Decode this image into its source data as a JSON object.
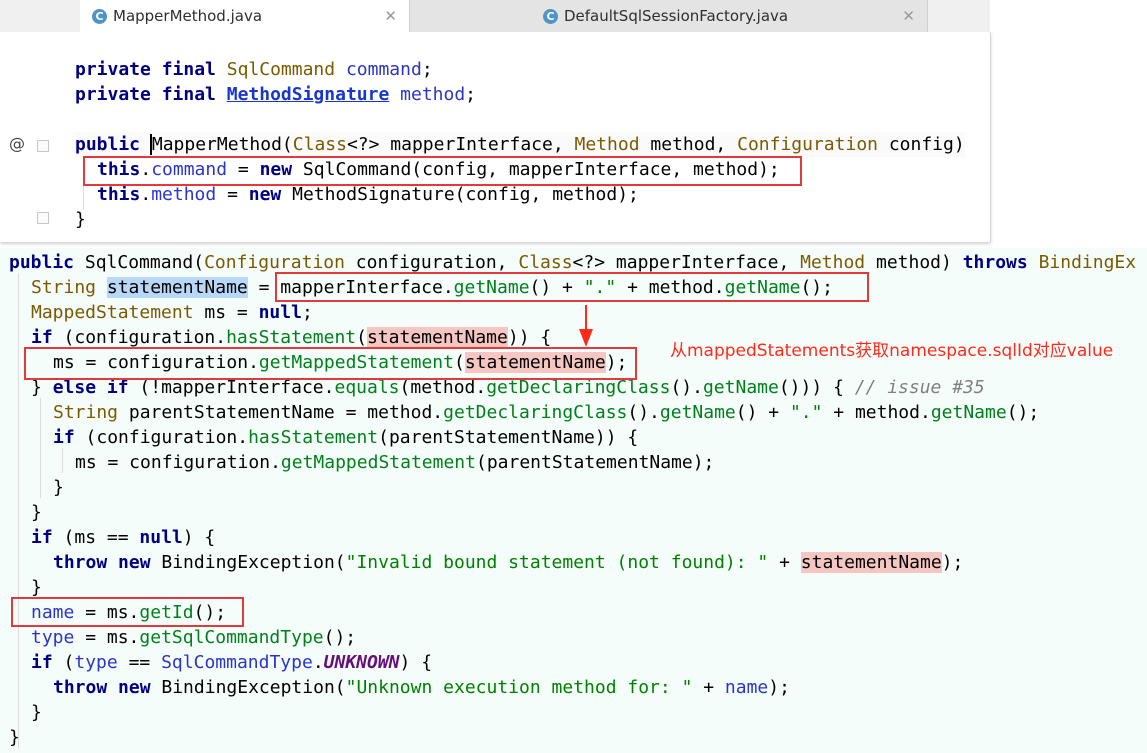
{
  "tabs": [
    {
      "icon": "C",
      "label": "MapperMethod.java",
      "active": true
    },
    {
      "icon": "C",
      "label": "DefaultSqlSessionFactory.java",
      "active": false
    }
  ],
  "top_code": {
    "gutter_symbol": "@",
    "l1": {
      "kw1": "private",
      "kw2": "final",
      "type": "SqlCommand",
      "field": "command",
      "end": ";"
    },
    "l2": {
      "kw1": "private",
      "kw2": "final",
      "type": "MethodSignature",
      "field": "method",
      "end": ";"
    },
    "l3": {
      "kw": "public",
      "name": "MapperMethod",
      "p1": "(",
      "t1": "Class",
      "p2": "<?> mapperInterface, ",
      "t2": "Method",
      "p3": " method, ",
      "t3": "Configuration",
      "p4": " config)"
    },
    "l4": {
      "this": "this",
      "dot": ".",
      "field": "command",
      "eq": " = ",
      "new": "new",
      "rest": " SqlCommand(config, mapperInterface, method);"
    },
    "l5": {
      "this": "this",
      "dot": ".",
      "field": "method",
      "eq": " = ",
      "new": "new",
      "rest": " MethodSignature(config, method);"
    },
    "l6": {
      "brace": "}"
    }
  },
  "bottom_code": {
    "l1": {
      "kw": "public",
      "a": " SqlCommand(",
      "t1": "Configuration",
      "b": " configuration, ",
      "t2": "Class",
      "c": "<?> mapperInterface, ",
      "t3": "Method",
      "d": " method) ",
      "kw2": "throws",
      "e": " BindingEx"
    },
    "l2": {
      "t": "String",
      "sp": " ",
      "var": "statementName",
      "eq": " = ",
      "a": "mapperInterface.",
      "m1": "getName",
      "b": "() + ",
      "s": "\".\"",
      "c": " + method.",
      "m2": "getName",
      "d": "();"
    },
    "l3": {
      "t": "MappedStatement",
      "a": " ms = ",
      "null": "null",
      "b": ";"
    },
    "l4": {
      "kw": "if",
      "a": " (configuration.",
      "m": "hasStatement",
      "b": "(",
      "var": "statementName",
      "c": ")) {"
    },
    "l5": {
      "a": "ms = configuration.",
      "m": "getMappedStatement",
      "b": "(",
      "var": "statementName",
      "c": ");"
    },
    "l6": {
      "a": "} ",
      "kw1": "else",
      "sp": " ",
      "kw2": "if",
      "b": " (!mapperInterface.",
      "m1": "equals",
      "c": "(method.",
      "m2": "getDeclaringClass",
      "d": "().",
      "m3": "getName",
      "e": "())) { ",
      "cmt": "// issue #35"
    },
    "l7": {
      "t": "String",
      "a": " parentStatementName = method.",
      "m1": "getDeclaringClass",
      "b": "().",
      "m2": "getName",
      "c": "() + ",
      "s": "\".\"",
      "d": " + method.",
      "m3": "getName",
      "e": "();"
    },
    "l8": {
      "kw": "if",
      "a": " (configuration.",
      "m": "hasStatement",
      "b": "(parentStatementName)) {"
    },
    "l9": {
      "a": "ms = configuration.",
      "m": "getMappedStatement",
      "b": "(parentStatementName);"
    },
    "l10": {
      "a": "}"
    },
    "l11": {
      "a": "}"
    },
    "l12": {
      "kw": "if",
      "a": " (ms == ",
      "null": "null",
      "b": ") {"
    },
    "l13": {
      "kw1": "throw",
      "sp": " ",
      "kw2": "new",
      "a": " BindingException(",
      "s": "\"Invalid bound statement (not found): \"",
      "b": " + ",
      "var": "statementName",
      "c": ");"
    },
    "l14": {
      "a": "}"
    },
    "l15": {
      "f": "name",
      "a": " = ms.",
      "m": "getId",
      "b": "();"
    },
    "l16": {
      "f": "type",
      "a": " = ms.",
      "m": "getSqlCommandType",
      "b": "();"
    },
    "l17": {
      "kw": "if",
      "a": " (",
      "f": "type",
      "b": " == ",
      "e": "SqlCommandType",
      "dot": ".",
      "c": "UNKNOWN",
      "d": ") {"
    },
    "l18": {
      "kw1": "throw",
      "sp": " ",
      "kw2": "new",
      "a": " BindingException(",
      "s": "\"Unknown execution method for: \"",
      "b": " + ",
      "f": "name",
      "c": ");"
    },
    "l19": {
      "a": "}"
    },
    "l20": {
      "a": "}"
    }
  },
  "annotation": "从mappedStatements获取namespace.sqlId对应value",
  "colors": {
    "highlight_box": "#e23a3a",
    "annotation": "#ff2a1a",
    "keyword": "#000080",
    "method": "#00801a",
    "field": "#660e7a"
  }
}
